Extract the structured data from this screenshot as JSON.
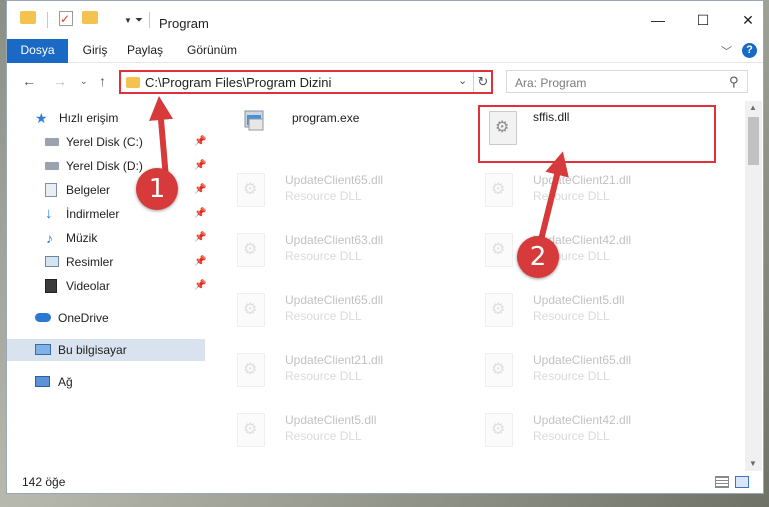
{
  "window": {
    "title": "Program",
    "controls": [
      "minimize-icon",
      "maximize-icon",
      "close-icon"
    ]
  },
  "ribbon": {
    "tabs": [
      "Dosya",
      "Giriş",
      "Paylaş",
      "Görünüm"
    ]
  },
  "address": {
    "path": "C:\\Program Files\\Program Dizini"
  },
  "search": {
    "placeholder": "Ara: Program"
  },
  "sidebar": {
    "items": [
      {
        "label": "Hızlı erişim",
        "icon": "star-icon",
        "pinned": false
      },
      {
        "label": "Yerel Disk (C:)",
        "icon": "drive-icon",
        "pinned": true
      },
      {
        "label": "Yerel Disk (D:)",
        "icon": "drive-icon",
        "pinned": true
      },
      {
        "label": "Belgeler",
        "icon": "documents-icon",
        "pinned": true
      },
      {
        "label": "İndirmeler",
        "icon": "download-icon",
        "pinned": true
      },
      {
        "label": "Müzik",
        "icon": "music-icon",
        "pinned": true
      },
      {
        "label": "Resimler",
        "icon": "pictures-icon",
        "pinned": true
      },
      {
        "label": "Videolar",
        "icon": "video-icon",
        "pinned": true
      },
      {
        "label": "OneDrive",
        "icon": "cloud-icon",
        "pinned": false
      },
      {
        "label": "Bu bilgisayar",
        "icon": "computer-icon",
        "pinned": false
      },
      {
        "label": "Ağ",
        "icon": "network-icon",
        "pinned": false
      }
    ]
  },
  "files": [
    {
      "name": "program.exe",
      "desc": ""
    },
    {
      "name": "sffis.dll",
      "desc": ""
    },
    {
      "name": "UpdateClient65.dll",
      "desc": "Resource DLL"
    },
    {
      "name": "UpdateClient21.dll",
      "desc": "Resource DLL"
    },
    {
      "name": "UpdateClient63.dll",
      "desc": "Resource DLL"
    },
    {
      "name": "UpdateClient42.dll",
      "desc": "Resource DLL"
    },
    {
      "name": "UpdateClient65.dll",
      "desc": "Resource DLL"
    },
    {
      "name": "UpdateClient5.dll",
      "desc": "Resource DLL"
    },
    {
      "name": "UpdateClient21.dll",
      "desc": "Resource DLL"
    },
    {
      "name": "UpdateClient65.dll",
      "desc": "Resource DLL"
    },
    {
      "name": "UpdateClient5.dll",
      "desc": "Resource DLL"
    },
    {
      "name": "UpdateClient42.dll",
      "desc": "Resource DLL"
    }
  ],
  "status": {
    "count": "142 öğe"
  },
  "annotations": {
    "step1": "1",
    "step2": "2",
    "color": "#d63a3a"
  }
}
